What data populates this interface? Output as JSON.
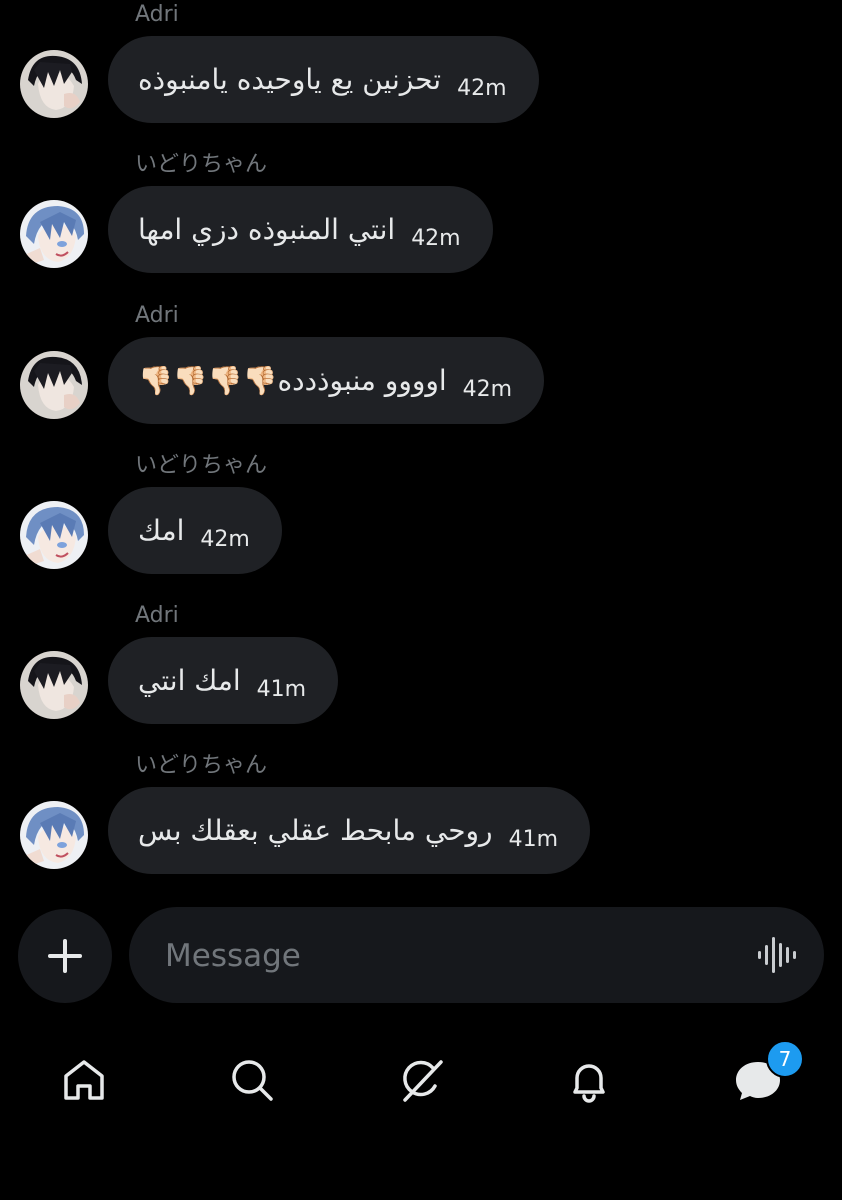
{
  "messages": [
    {
      "sender": "Adri",
      "text": "تحزنين يع ياوحيده يامنبوذه",
      "time": "42m"
    },
    {
      "sender": "いどりちゃん",
      "text": "انتي المنبوذه دزي امها",
      "time": "42m"
    },
    {
      "sender": "Adri",
      "text": "اوووو منبوذدده👎🏻👎🏻👎🏻👎🏻",
      "time": "42m"
    },
    {
      "sender": "いどりちゃん",
      "text": "امك",
      "time": "42m"
    },
    {
      "sender": "Adri",
      "text": "امك انتي",
      "time": "41m"
    },
    {
      "sender": "いどりちゃん",
      "text": "روحي مابحط عقلي بعقلك بس",
      "time": "41m"
    }
  ],
  "composer": {
    "placeholder": "Message",
    "add_icon": "plus-icon",
    "voice_icon": "waveform-icon"
  },
  "nav": {
    "items": [
      "home-icon",
      "search-icon",
      "grok-icon",
      "notifications-bell-icon",
      "messages-icon"
    ],
    "messages_badge": "7"
  },
  "colors": {
    "background": "#000000",
    "bubble": "#1f2125",
    "muted": "#71767b",
    "accent": "#1d9bf0"
  }
}
